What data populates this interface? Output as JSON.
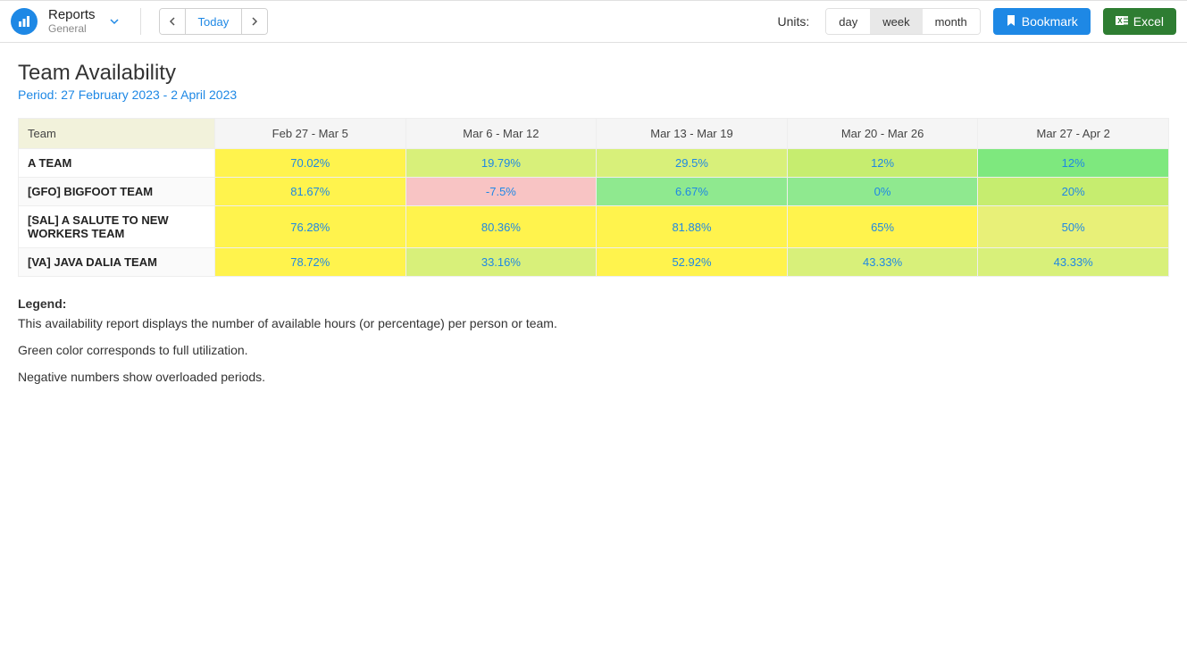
{
  "header": {
    "title": "Reports",
    "subtitle": "General",
    "today_label": "Today",
    "units_label": "Units:",
    "units": {
      "day": "day",
      "week": "week",
      "month": "month",
      "active": "week"
    },
    "bookmark_label": "Bookmark",
    "excel_label": "Excel"
  },
  "report": {
    "title": "Team Availability",
    "period": "Period: 27 February 2023 - 2 April 2023",
    "team_header": "Team",
    "columns": [
      "Feb 27 - Mar 5",
      "Mar 6 - Mar 12",
      "Mar 13 - Mar 19",
      "Mar 20 - Mar 26",
      "Mar 27 - Apr 2"
    ],
    "rows": [
      {
        "team": "A TEAM",
        "values": [
          "70.02%",
          "19.79%",
          "29.5%",
          "12%",
          "12%"
        ],
        "colors": [
          "#fff34d",
          "#d8f07a",
          "#d8f07a",
          "#c6ed6f",
          "#7ee87e"
        ]
      },
      {
        "team": "[GFO] BIGFOOT TEAM",
        "values": [
          "81.67%",
          "-7.5%",
          "6.67%",
          "0%",
          "20%"
        ],
        "colors": [
          "#fff34d",
          "#f8c4c4",
          "#8fe98f",
          "#8fe98f",
          "#c6ed6f"
        ]
      },
      {
        "team": "[SAL] A SALUTE TO NEW WORKERS TEAM",
        "values": [
          "76.28%",
          "80.36%",
          "81.88%",
          "65%",
          "50%"
        ],
        "colors": [
          "#fff34d",
          "#fff34d",
          "#fff34d",
          "#fff34d",
          "#e8f078"
        ]
      },
      {
        "team": "[VA] JAVA DALIA TEAM",
        "values": [
          "78.72%",
          "33.16%",
          "52.92%",
          "43.33%",
          "43.33%"
        ],
        "colors": [
          "#fff34d",
          "#d8f07a",
          "#fff34d",
          "#d8f07a",
          "#d8f07a"
        ]
      }
    ]
  },
  "legend": {
    "title": "Legend:",
    "line1": "This availability report displays the number of available hours (or percentage) per person or team.",
    "line2": "Green color corresponds to full utilization.",
    "line3": "Negative numbers show overloaded periods."
  }
}
